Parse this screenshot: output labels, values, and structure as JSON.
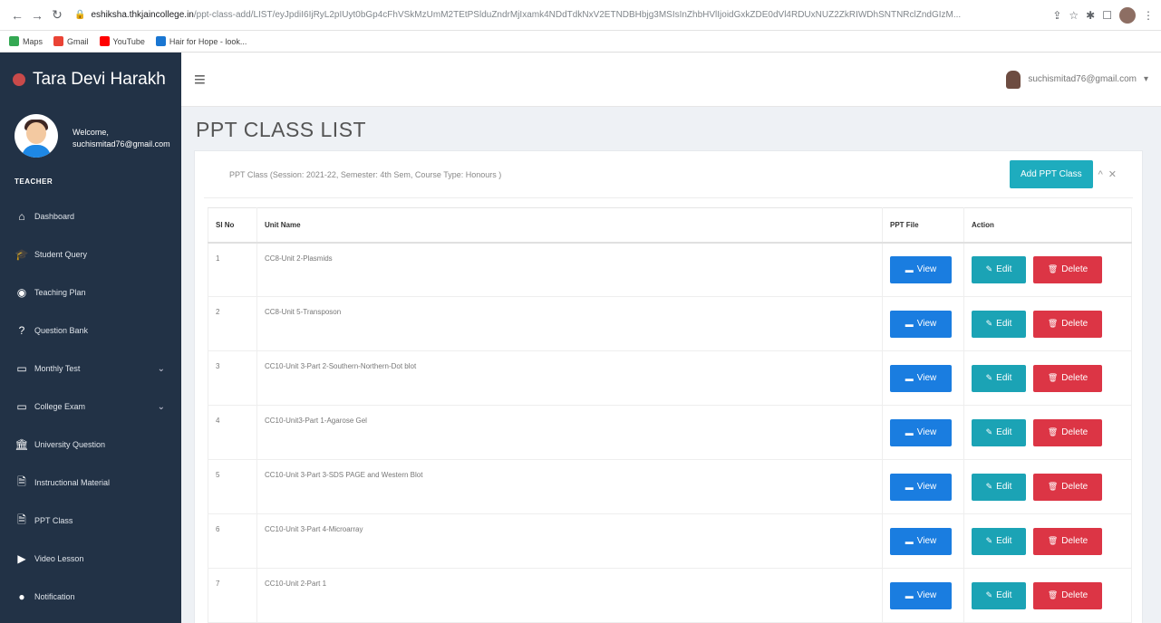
{
  "browser": {
    "url_host": "eshiksha.thkjaincollege.in",
    "url_path": "/ppt-class-add/LIST/eyJpdiI6IjRyL2pIUyt0bGp4cFhVSkMzUmM2TEtPSlduZndrMjIxamk4NDdTdkNxV2ETNDBHbjg3MSIsInZhbHVlIjoidGxkZDE0dVl4RDUxNUZ2ZkRIWDhSNTNRclZndGIzM...",
    "bookmarks": [
      {
        "label": "Maps",
        "color": "#34a853"
      },
      {
        "label": "Gmail",
        "color": "#ea4335"
      },
      {
        "label": "YouTube",
        "color": "#ff0000"
      },
      {
        "label": "Hair for Hope - look...",
        "color": "#1976d2"
      }
    ]
  },
  "app": {
    "brand": "Tara Devi Harakh",
    "user_email": "suchismitad76@gmail.com"
  },
  "sidebar": {
    "welcome": "Welcome,",
    "username": "suchismitad76@gmail.com",
    "role": "TEACHER",
    "items": [
      {
        "label": "Dashboard",
        "icon": "home-icon",
        "glyph": "⌂"
      },
      {
        "label": "Student Query",
        "icon": "graduation-cap-icon",
        "glyph": "🎓"
      },
      {
        "label": "Teaching Plan",
        "icon": "target-icon",
        "glyph": "◉"
      },
      {
        "label": "Question Bank",
        "icon": "question-icon",
        "glyph": "?"
      },
      {
        "label": "Monthly Test",
        "icon": "monitor-icon",
        "glyph": "▭",
        "chevron": "⌄"
      },
      {
        "label": "College Exam",
        "icon": "monitor-icon",
        "glyph": "▭",
        "chevron": "⌄"
      },
      {
        "label": "University Question",
        "icon": "bank-icon",
        "glyph": "🏛"
      },
      {
        "label": "Instructional Material",
        "icon": "document-icon",
        "glyph": "🗎"
      },
      {
        "label": "PPT Class",
        "icon": "document-icon",
        "glyph": "🗎"
      },
      {
        "label": "Video Lesson",
        "icon": "video-icon",
        "glyph": "▶"
      },
      {
        "label": "Notification",
        "icon": "bell-icon",
        "glyph": "●"
      }
    ]
  },
  "page": {
    "title": "PPT CLASS LIST",
    "caption": "PPT Class (Session: 2021-22, Semester: 4th Sem, Course Type: Honours )",
    "add_button": "Add PPT Class",
    "collapse": "^",
    "close": "✕"
  },
  "table": {
    "headers": [
      "Sl No",
      "Unit Name",
      "PPT File",
      "Action"
    ],
    "view_label": "View",
    "edit_label": "Edit",
    "delete_label": "Delete",
    "rows": [
      {
        "sl": "1",
        "unit": "CC8-Unit 2-Plasmids"
      },
      {
        "sl": "2",
        "unit": "CC8-Unit 5-Transposon"
      },
      {
        "sl": "3",
        "unit": "CC10-Unit 3-Part 2-Southern-Northern-Dot blot"
      },
      {
        "sl": "4",
        "unit": "CC10-Unit3-Part 1-Agarose Gel"
      },
      {
        "sl": "5",
        "unit": "CC10-Unit 3-Part 3-SDS PAGE and Western Blot"
      },
      {
        "sl": "6",
        "unit": "CC10-Unit 3-Part 4-Microarray"
      },
      {
        "sl": "7",
        "unit": "CC10-Unit 2-Part 1"
      }
    ]
  }
}
